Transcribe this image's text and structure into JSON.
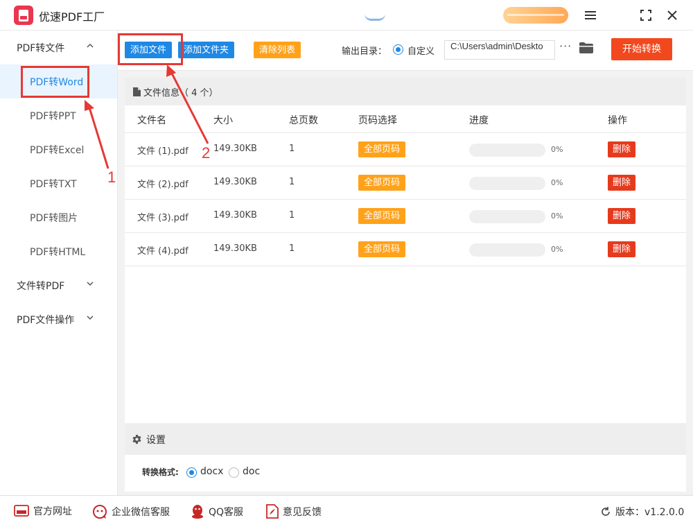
{
  "app": {
    "title": "优速PDF工厂",
    "user_name": "",
    "vip_label": ""
  },
  "colors": {
    "primary": "#1e88e5",
    "orange": "#ffa21a",
    "danger": "#e63a1d",
    "start": "#f2481e",
    "annotation": "#e53935"
  },
  "sidebar": {
    "groups": [
      {
        "label": "PDF转文件",
        "expanded": true
      },
      {
        "label": "文件转PDF",
        "expanded": false
      },
      {
        "label": "PDF文件操作",
        "expanded": false
      }
    ],
    "items": [
      {
        "label": "PDF转Word",
        "active": true
      },
      {
        "label": "PDF转PPT",
        "active": false
      },
      {
        "label": "PDF转Excel",
        "active": false
      },
      {
        "label": "PDF转TXT",
        "active": false
      },
      {
        "label": "PDF转图片",
        "active": false
      },
      {
        "label": "PDF转HTML",
        "active": false
      }
    ]
  },
  "toolbar": {
    "add_file": "添加文件",
    "add_folder": "添加文件夹",
    "clear_list": "清除列表",
    "output_label": "输出目录：",
    "custom_label": "自定义",
    "output_path": "C:\\Users\\admin\\Deskto",
    "more": "···",
    "start": "开始转换"
  },
  "file_panel": {
    "title": "文件信息（ 4 个）",
    "headers": [
      "文件名",
      "大小",
      "总页数",
      "页码选择",
      "进度",
      "操作"
    ],
    "rows": [
      {
        "name": "文件 (1).pdf",
        "size": "149.30KB",
        "pages": "1",
        "page_select": "全部页码",
        "progress": 0,
        "progress_text": "0%",
        "action": "删除"
      },
      {
        "name": "文件 (2).pdf",
        "size": "149.30KB",
        "pages": "1",
        "page_select": "全部页码",
        "progress": 0,
        "progress_text": "0%",
        "action": "删除"
      },
      {
        "name": "文件 (3).pdf",
        "size": "149.30KB",
        "pages": "1",
        "page_select": "全部页码",
        "progress": 0,
        "progress_text": "0%",
        "action": "删除"
      },
      {
        "name": "文件 (4).pdf",
        "size": "149.30KB",
        "pages": "1",
        "page_select": "全部页码",
        "progress": 0,
        "progress_text": "0%",
        "action": "删除"
      }
    ]
  },
  "settings": {
    "title": "设置",
    "format_label": "转换格式:",
    "options": [
      {
        "label": "docx",
        "checked": true
      },
      {
        "label": "doc",
        "checked": false
      }
    ]
  },
  "annotations": {
    "step1": "1",
    "step2": "2"
  },
  "footer": {
    "links": [
      "官方网址",
      "企业微信客服",
      "QQ客服",
      "意见反馈"
    ],
    "version": "版本：v1.2.0.0"
  }
}
